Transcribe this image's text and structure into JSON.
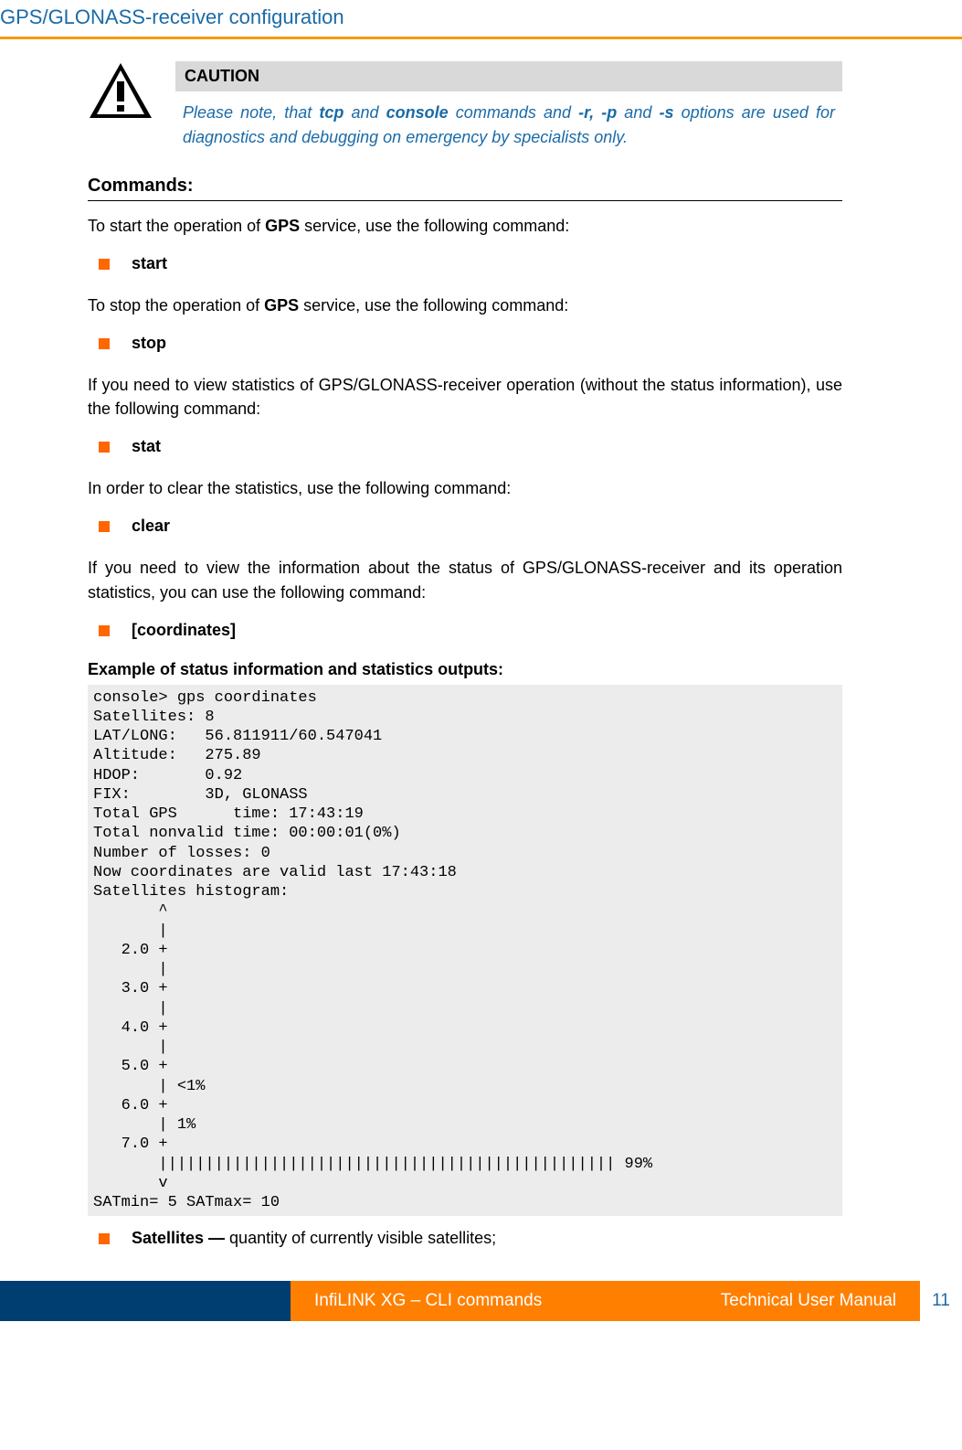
{
  "header": {
    "title": "GPS/GLONASS-receiver configuration"
  },
  "caution": {
    "heading": "CAUTION",
    "text_parts": [
      {
        "t": "Please note, that ",
        "b": false
      },
      {
        "t": "tcp",
        "b": true
      },
      {
        "t": " and ",
        "b": false
      },
      {
        "t": "console",
        "b": true
      },
      {
        "t": " commands and ",
        "b": false
      },
      {
        "t": "-r, -p",
        "b": true
      },
      {
        "t": " and ",
        "b": false
      },
      {
        "t": "-s",
        "b": true
      },
      {
        "t": " options are used for diagnostics and debugging on emergency by specialists only.",
        "b": false
      }
    ]
  },
  "commands": {
    "title": "Commands:",
    "items": [
      {
        "intro_parts": [
          {
            "t": "To start the operation of ",
            "b": false
          },
          {
            "t": "GPS",
            "b": true
          },
          {
            "t": " service, use the following command:",
            "b": false
          }
        ],
        "label": "start"
      },
      {
        "intro_parts": [
          {
            "t": "To stop the operation of ",
            "b": false
          },
          {
            "t": "GPS",
            "b": true
          },
          {
            "t": " service, use the following command:",
            "b": false
          }
        ],
        "label": "stop"
      },
      {
        "intro_parts": [
          {
            "t": "If you need to view statistics of GPS/GLONASS-receiver operation (without the status information), use the following command:",
            "b": false
          }
        ],
        "label": "stat"
      },
      {
        "intro_parts": [
          {
            "t": "In order to clear the statistics, use the following command:",
            "b": false
          }
        ],
        "label": "clear"
      },
      {
        "intro_parts": [
          {
            "t": "If you need to view the information about the status of GPS/GLONASS-receiver and its operation statistics, you can use the following command:",
            "b": false
          }
        ],
        "label": "[coordinates]"
      }
    ]
  },
  "example": {
    "title": "Example of status information and statistics outputs:",
    "code": "console> gps coordinates\nSatellites: 8\nLAT/LONG:   56.811911/60.547041\nAltitude:   275.89\nHDOP:       0.92\nFIX:        3D, GLONASS\nTotal GPS      time: 17:43:19\nTotal nonvalid time: 00:00:01(0%)\nNumber of losses: 0\nNow coordinates are valid last 17:43:18\nSatellites histogram:\n       ^\n       |\n   2.0 +\n       |\n   3.0 +\n       |\n   4.0 +\n       |\n   5.0 +\n       | <1%\n   6.0 +\n       | 1%\n   7.0 +\n       ||||||||||||||||||||||||||||||||||||||||||||||||| 99%\n       v\nSATmin= 5 SATmax= 10"
  },
  "sat_line": {
    "bold": "Satellites — ",
    "rest": "quantity of currently visible satellites;"
  },
  "footer": {
    "left_label": "InfiLINK XG – CLI commands",
    "right_label": "Technical User Manual",
    "page": "11"
  }
}
